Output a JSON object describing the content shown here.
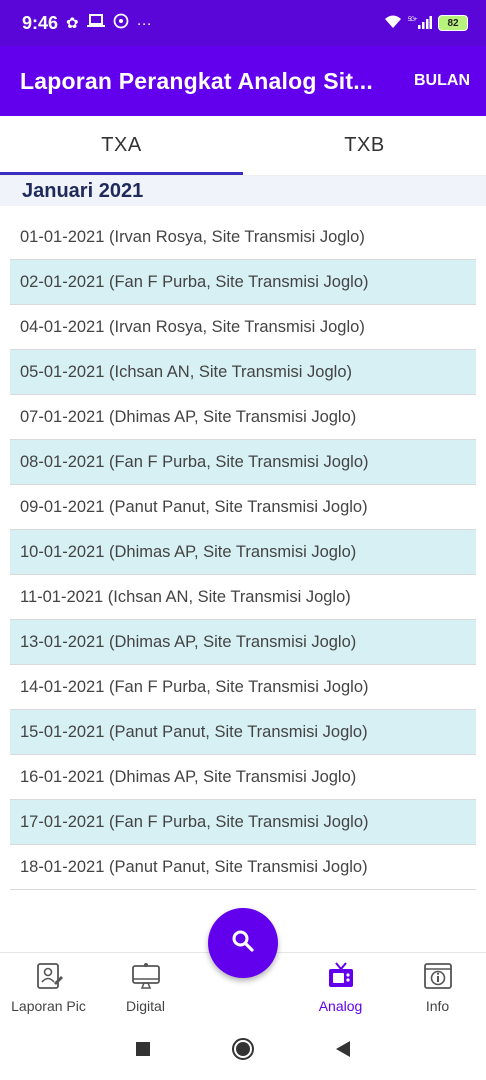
{
  "status_bar": {
    "time": "9:46",
    "battery": "82",
    "network": "5G+"
  },
  "app_bar": {
    "title": "Laporan Perangkat Analog Sit...",
    "action": "BULAN"
  },
  "tabs": [
    {
      "label": "TXA",
      "active": true
    },
    {
      "label": "TXB",
      "active": false
    }
  ],
  "month_header": "Januari 2021",
  "rows": [
    "01-01-2021 (Irvan Rosya, Site Transmisi Joglo)",
    "02-01-2021 (Fan F Purba, Site Transmisi Joglo)",
    "04-01-2021 (Irvan Rosya, Site Transmisi Joglo)",
    "05-01-2021 (Ichsan AN, Site Transmisi Joglo)",
    "07-01-2021 (Dhimas AP, Site Transmisi Joglo)",
    "08-01-2021 (Fan F Purba, Site Transmisi Joglo)",
    "09-01-2021 (Panut Panut, Site Transmisi Joglo)",
    "10-01-2021 (Dhimas AP, Site Transmisi Joglo)",
    "11-01-2021 (Ichsan AN, Site Transmisi Joglo)",
    "13-01-2021 (Dhimas AP, Site Transmisi Joglo)",
    "14-01-2021 (Fan F Purba, Site Transmisi Joglo)",
    "15-01-2021 (Panut Panut, Site Transmisi Joglo)",
    "16-01-2021 (Dhimas AP, Site Transmisi Joglo)",
    "17-01-2021 (Fan F Purba, Site Transmisi Joglo)",
    "18-01-2021 (Panut Panut, Site Transmisi Joglo)"
  ],
  "bottom_nav": [
    {
      "label": "Laporan Pic",
      "icon": "report-pic-icon",
      "active": false
    },
    {
      "label": "Digital",
      "icon": "monitor-icon",
      "active": false
    },
    {
      "label": "Analog",
      "icon": "tv-icon",
      "active": true
    },
    {
      "label": "Info",
      "icon": "info-icon",
      "active": false
    }
  ],
  "colors": {
    "primary": "#6200ee",
    "status_bar": "#5b06d9",
    "row_alt": "#d7f0f4",
    "tab_indicator": "#3a2fc0"
  }
}
